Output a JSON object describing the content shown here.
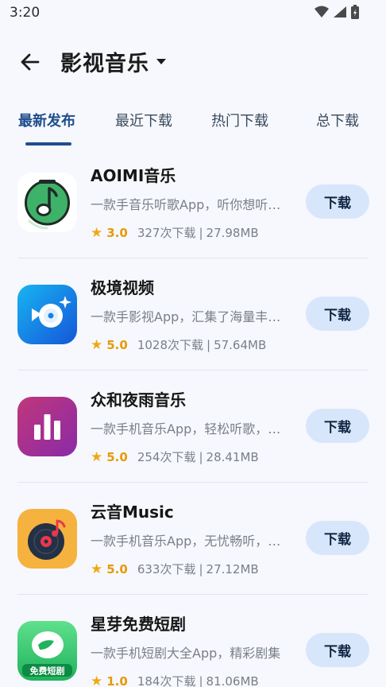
{
  "status": {
    "time": "3:20"
  },
  "header": {
    "title": "影视音乐"
  },
  "tabs": [
    {
      "label": "最新发布"
    },
    {
      "label": "最近下载"
    },
    {
      "label": "热门下载"
    },
    {
      "label": "总下载"
    }
  ],
  "apps": [
    {
      "name": "AOIMI音乐",
      "desc": "一款手音乐听歌App，听你想听的歌",
      "rating": "3.0",
      "downloads": "327次下载",
      "sep": "|",
      "size": "27.98MB",
      "button": "下载",
      "icon": "music-note-icon"
    },
    {
      "name": "极境视频",
      "desc": "一款手影视App，汇集了海量丰富影视",
      "rating": "5.0",
      "downloads": "1028次下载",
      "sep": "|",
      "size": "57.64MB",
      "button": "下载",
      "icon": "video-disc-icon"
    },
    {
      "name": "众和夜雨音乐",
      "desc": "一款手机音乐App，轻松听歌，畅享音乐",
      "rating": "5.0",
      "downloads": "254次下载",
      "sep": "|",
      "size": "28.41MB",
      "button": "下载",
      "icon": "bar-chart-icon"
    },
    {
      "name": "云音Music",
      "desc": "一款手机音乐App，无忧畅听，海量曲库",
      "rating": "5.0",
      "downloads": "633次下载",
      "sep": "|",
      "size": "27.12MB",
      "button": "下载",
      "icon": "vinyl-record-icon"
    },
    {
      "name": "星芽免费短剧",
      "desc": "一款手机短剧大全App，精彩剧集",
      "rating": "1.0",
      "downloads": "184次下载",
      "sep": "|",
      "size": "81.06MB",
      "button": "下载",
      "icon": "short-drama-icon",
      "icon_text": "免费短剧"
    }
  ],
  "colors": {
    "accent": "#1f4e8c",
    "button_bg": "#d8e6fb",
    "star": "#f3a712"
  }
}
